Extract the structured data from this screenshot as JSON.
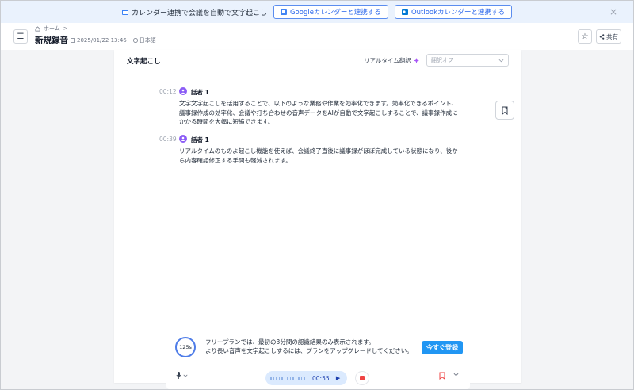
{
  "banner": {
    "text": "カレンダー連携で会議を自動で文字起こし",
    "google_label": "Googleカレンダーと連携する",
    "outlook_label": "Outlookカレンダーと連携する",
    "close": "×"
  },
  "header": {
    "breadcrumb_home": "ホーム",
    "breadcrumb_sep": ">",
    "title": "新規録音",
    "date": "2025/01/22 13:46",
    "language": "日本語",
    "share_label": "共有"
  },
  "card": {
    "title": "文字起こし",
    "realtime_label": "リアルタイム翻訳",
    "translate_select": "翻訳オフ"
  },
  "entries": [
    {
      "time": "00:12",
      "speaker": "話者 1",
      "text": "文字文字起こしを活用することで、以下のような業務や作業を効率化できます。効率化できるポイント、議事録作成の効率化、会議や打ち合わせの音声データをAIが自動で文字起こしすることで、議事録作成にかかる時間を大幅に短縮できます。"
    },
    {
      "time": "00:39",
      "speaker": "話者 1",
      "text": "リアルタイムのものよ起こし機能を使えば、会議終了直後に議事録がほぼ完成している状態になり、後から内容確認修正する手間も軽減されます。"
    }
  ],
  "upgrade": {
    "timer": "125s",
    "line1": "フリープランでは、最初の3分間の認識結果のみ表示されます。",
    "line2": "より長い音声を文字起こしするには、プランをアップグレードしてください。",
    "button": "今すぐ登録"
  },
  "player": {
    "time": "00:55"
  }
}
